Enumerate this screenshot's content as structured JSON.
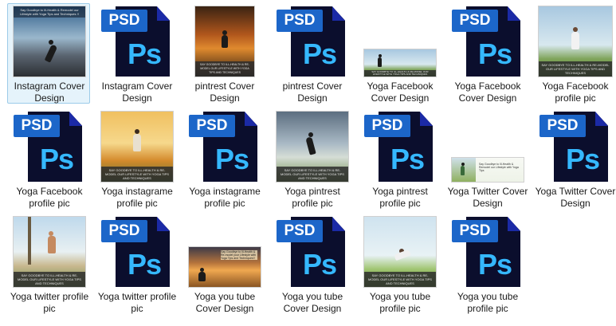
{
  "files": [
    {
      "label": "Instagram Cover Design",
      "type": "image",
      "icon": "yoga-instagram-cover-thumbnail",
      "selected": true
    },
    {
      "label": "Instagram Cover Design",
      "type": "psd",
      "icon": "psd-file-icon"
    },
    {
      "label": "pintrest Cover Design",
      "type": "image",
      "icon": "yoga-pintrest-cover-thumbnail"
    },
    {
      "label": "pintrest Cover Design",
      "type": "psd",
      "icon": "psd-file-icon"
    },
    {
      "label": "Yoga Facebook Cover Design",
      "type": "image",
      "icon": "yoga-facebook-cover-thumbnail"
    },
    {
      "label": "Yoga Facebook Cover Design",
      "type": "psd",
      "icon": "psd-file-icon"
    },
    {
      "label": "Yoga Facebook profile pic",
      "type": "image",
      "icon": "yoga-facebook-profile-thumbnail"
    },
    {
      "label": "Yoga Facebook profile pic",
      "type": "psd",
      "icon": "psd-file-icon"
    },
    {
      "label": "Yoga instagrame profile pic",
      "type": "image",
      "icon": "yoga-instagrame-profile-thumbnail"
    },
    {
      "label": "Yoga instagrame profile pic",
      "type": "psd",
      "icon": "psd-file-icon"
    },
    {
      "label": "Yoga pintrest profile pic",
      "type": "image",
      "icon": "yoga-pintrest-profile-thumbnail"
    },
    {
      "label": "Yoga pintrest profile pic",
      "type": "psd",
      "icon": "psd-file-icon"
    },
    {
      "label": "Yoga Twitter Cover Design",
      "type": "image",
      "icon": "yoga-twitter-cover-thumbnail"
    },
    {
      "label": "Yoga Twitter Cover Design",
      "type": "psd",
      "icon": "psd-file-icon"
    },
    {
      "label": "Yoga twitter profile pic",
      "type": "image",
      "icon": "yoga-twitter-profile-thumbnail"
    },
    {
      "label": "Yoga twitter profile pic",
      "type": "psd",
      "icon": "psd-file-icon"
    },
    {
      "label": "Yoga you tube Cover Design",
      "type": "image",
      "icon": "yoga-youtube-cover-thumbnail"
    },
    {
      "label": "Yoga you tube Cover Design",
      "type": "psd",
      "icon": "psd-file-icon"
    },
    {
      "label": "Yoga you tube profile pic",
      "type": "image",
      "icon": "yoga-youtube-profile-thumbnail"
    },
    {
      "label": "Yoga you tube profile pic",
      "type": "psd",
      "icon": "psd-file-icon"
    }
  ],
  "psd_icon": {
    "tab_text": "PSD",
    "glyph_text": "Ps"
  },
  "thumbnail_text": {
    "instagram_cover": "Say Goodbye to Ill-Health & Remodel our Lifestyle with Yoga Tips and Techniques !!",
    "pintrest_cover": "SAY GOODBYE TO ILL-HEALTH & RE-MODEL OUR LIFESTYLE WITH YOGA TIPS AND TECHNIQUES",
    "generic_banner": "SAY GOODBYE TO ILL-HEALTH & RE-MODEL OUR LIFESTYLE WITH YOGA TIPS AND TECHNIQUES",
    "twitter_cover": "Say Goodbye to Ill-Health & Remodel our Lifestyle with Yoga Tips",
    "youtube_cover": "Say Goodbye to Ill-Health & Re-model your Lifestyle with Yoga Tips and Techniques!!"
  },
  "colors": {
    "selection_bg": "#e5f3fb",
    "selection_border": "#9ccbe9",
    "psd_blue": "#1c66c9",
    "ps_text": "#35b8ff",
    "psd_sheet": "#0b0e2d"
  }
}
